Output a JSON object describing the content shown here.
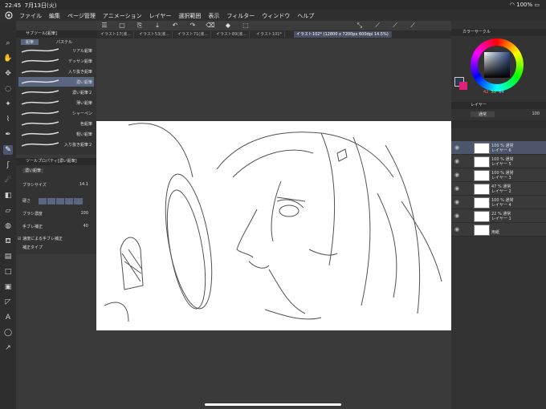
{
  "status": {
    "time": "22:45",
    "date": "7月13日(火)",
    "battery": "100%"
  },
  "menu": {
    "items": [
      "ファイル",
      "編集",
      "ページ管理",
      "アニメーション",
      "レイヤー",
      "選択範囲",
      "表示",
      "フィルター",
      "ウィンドウ",
      "ヘルプ"
    ]
  },
  "tabs": [
    "イラスト17(液...",
    "イラスト53(液...",
    "イラスト71(液...",
    "イラスト89(液...",
    "イラスト101*",
    "イラスト102* (12800 x 7200px 600dpi 14.5%)"
  ],
  "subtool": {
    "title": "サブツール[鉛筆]",
    "tab1": "鉛筆",
    "tab2": "パステル",
    "brushes": [
      "リアル鉛筆",
      "デッサン鉛筆",
      "入り抜き鉛筆",
      "濃い鉛筆",
      "濃い鉛筆２",
      "薄い鉛筆",
      "シャーペン",
      "色鉛筆",
      "粗い鉛筆",
      "入り抜き鉛筆２"
    ],
    "selected_index": 3
  },
  "toolprop": {
    "title": "ツールプロパティ[濃い鉛筆]",
    "name": "濃い鉛筆",
    "brush_size_label": "ブラシサイズ",
    "brush_size_value": "14.1",
    "hardness_label": "硬さ",
    "density_label": "ブラシ濃度",
    "density_value": "100",
    "stab_label": "手ブレ補正",
    "stab_value": "40",
    "speed_label": "速度による手ブレ補正",
    "correction_label": "補正タイプ"
  },
  "colorwheel": {
    "title": "カラーサークル",
    "r": "42",
    "g": "55",
    "b": "64"
  },
  "layers": {
    "title": "レイヤー",
    "blend": "通常",
    "opacity": "100",
    "items": [
      {
        "pct": "100 %  通常",
        "name": "レイヤー 6"
      },
      {
        "pct": "100 %  通常",
        "name": "レイヤー 5"
      },
      {
        "pct": "100 %  通常",
        "name": "レイヤー 3"
      },
      {
        "pct": "47 %  通常",
        "name": "レイヤー 2"
      },
      {
        "pct": "100 %  通常",
        "name": "レイヤー 4"
      },
      {
        "pct": "22 %  通常",
        "name": "レイヤー 1"
      },
      {
        "pct": "",
        "name": "用紙"
      }
    ],
    "selected_index": 0
  },
  "colors": {
    "accent": "#5a6680",
    "main_color": "#2a3a4a",
    "sub_color": "#e0207a"
  }
}
